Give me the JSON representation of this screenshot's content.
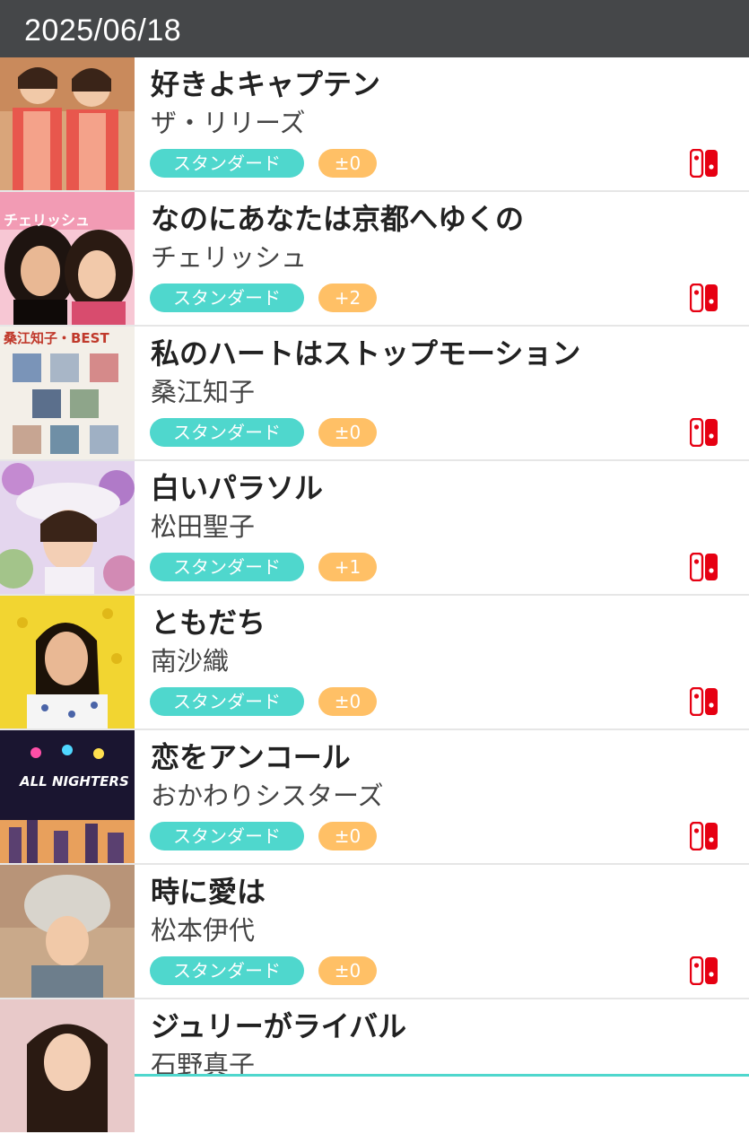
{
  "header": {
    "date": "2025/06/18"
  },
  "colors": {
    "header_bg": "#454749",
    "standard_badge": "#4fd7cd",
    "key_badge": "#ffc066",
    "switch_red": "#e60012"
  },
  "songs": [
    {
      "title": "好きよキャプテン",
      "artist": "ザ・リリーズ",
      "mode": "スタンダード",
      "key": "±0",
      "platform_icon": "nintendo-switch-icon"
    },
    {
      "title": "なのにあなたは京都へゆくの",
      "artist": "チェリッシュ",
      "mode": "スタンダード",
      "key": "+2",
      "platform_icon": "nintendo-switch-icon",
      "cover_text": "チェリッシュ"
    },
    {
      "title": "私のハートはストップモーション",
      "artist": "桑江知子",
      "mode": "スタンダード",
      "key": "±0",
      "platform_icon": "nintendo-switch-icon",
      "cover_text": "桑江知子・BEST"
    },
    {
      "title": "白いパラソル",
      "artist": "松田聖子",
      "mode": "スタンダード",
      "key": "+1",
      "platform_icon": "nintendo-switch-icon"
    },
    {
      "title": "ともだち",
      "artist": "南沙織",
      "mode": "スタンダード",
      "key": "±0",
      "platform_icon": "nintendo-switch-icon"
    },
    {
      "title": "恋をアンコール",
      "artist": "おかわりシスターズ",
      "mode": "スタンダード",
      "key": "±0",
      "platform_icon": "nintendo-switch-icon",
      "cover_text": "ALL NIGHTERS"
    },
    {
      "title": "時に愛は",
      "artist": "松本伊代",
      "mode": "スタンダード",
      "key": "±0",
      "platform_icon": "nintendo-switch-icon"
    },
    {
      "title": "ジュリーがライバル",
      "artist": "石野真子"
    }
  ]
}
